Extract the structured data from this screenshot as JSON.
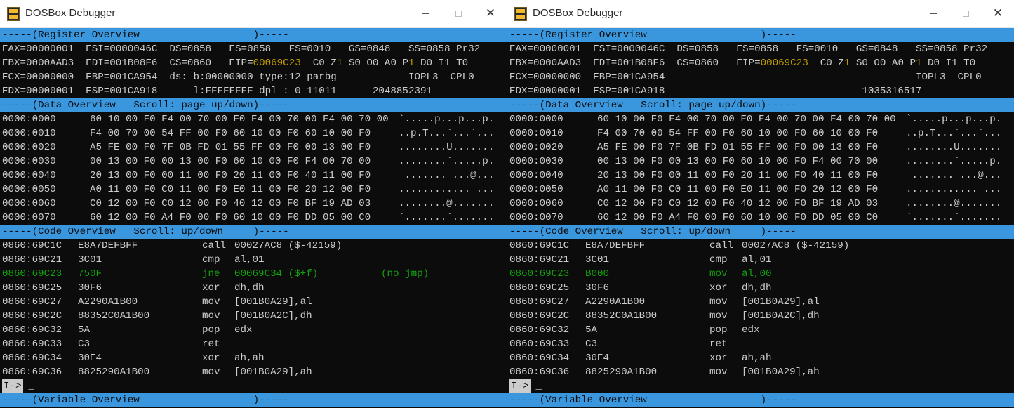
{
  "windows": {
    "left": {
      "title": "DOSBox Debugger",
      "registers": {
        "header": "-----(Register Overview                   )-----",
        "r1": {
          "a": "EAX=00000001  ESI=0000046C  DS=0858   ES=0858   FS=0010   GS=0848   SS=0858 Pr32",
          "eip_val": "",
          "b": ""
        },
        "r2": {
          "a": "EBX=0000AAD3  EDI=001B08F6  CS=0860   EIP=",
          "eip_val": "00069C23",
          "flags_a": "  C0 Z",
          "z": "1",
          "flags_b": " S0 O0 A0 P",
          "p": "1",
          "flags_c": " D0 I1 T0"
        },
        "r3": "ECX=00000000  EBP=001CA954  ds: b:00000000 type:12 parbg            IOPL3  CPL0",
        "r4": "EDX=00000001  ESP=001CA918      l:FFFFFFFF dpl : 0 11011      2048852391"
      },
      "data": {
        "header": "-----(Data Overview   Scroll: page up/down)-----",
        "rows": [
          {
            "addr": "0000:0000",
            "hex": "60 10 00 F0 F4 00 70 00 F0 F4 00 70 00 F4 00 70 00",
            "ascii": "`.....p...p...p."
          },
          {
            "addr": "0000:0010",
            "hex": "F4 00 70 00 54 FF 00 F0 60 10 00 F0 60 10 00 F0",
            "ascii": "..p.T...`...`..."
          },
          {
            "addr": "0000:0020",
            "hex": "A5 FE 00 F0 7F 0B FD 01 55 FF 00 F0 00 13 00 F0",
            "ascii": "........U......."
          },
          {
            "addr": "0000:0030",
            "hex": "00 13 00 F0 00 13 00 F0 60 10 00 F0 F4 00 70 00",
            "ascii": "........`.....p."
          },
          {
            "addr": "0000:0040",
            "hex": "20 13 00 F0 00 11 00 F0 20 11 00 F0 40 11 00 F0",
            "ascii": " ....... ...@..."
          },
          {
            "addr": "0000:0050",
            "hex": "A0 11 00 F0 C0 11 00 F0 E0 11 00 F0 20 12 00 F0",
            "ascii": "............ ..."
          },
          {
            "addr": "0000:0060",
            "hex": "C0 12 00 F0 C0 12 00 F0 40 12 00 F0 BF 19 AD 03",
            "ascii": "........@......."
          },
          {
            "addr": "0000:0070",
            "hex": "60 12 00 F0 A4 F0 00 F0 60 10 00 F0 DD 05 00 C0",
            "ascii": "`.......`......."
          }
        ]
      },
      "code": {
        "header": "-----(Code Overview   Scroll: up/down     )-----",
        "rows": [
          {
            "addr": "0860:69C1C",
            "bytes": "E8A7DEFBFF",
            "mn": "call",
            "op": "00027AC8 ($-42159)",
            "note": "",
            "hl": false
          },
          {
            "addr": "0860:69C21",
            "bytes": "3C01",
            "mn": "cmp",
            "op": "al,01",
            "note": "",
            "hl": false
          },
          {
            "addr": "0860:69C23",
            "bytes": "750F",
            "mn": "jne",
            "op": "00069C34 ($+f)",
            "note": "(no jmp)",
            "hl": true
          },
          {
            "addr": "0860:69C25",
            "bytes": "30F6",
            "mn": "xor",
            "op": "dh,dh",
            "note": "",
            "hl": false
          },
          {
            "addr": "0860:69C27",
            "bytes": "A2290A1B00",
            "mn": "mov",
            "op": "[001B0A29],al",
            "note": "",
            "hl": false
          },
          {
            "addr": "0860:69C2C",
            "bytes": "88352C0A1B00",
            "mn": "mov",
            "op": "[001B0A2C],dh",
            "note": "",
            "hl": false
          },
          {
            "addr": "0860:69C32",
            "bytes": "5A",
            "mn": "pop",
            "op": "edx",
            "note": "",
            "hl": false
          },
          {
            "addr": "0860:69C33",
            "bytes": "C3",
            "mn": "ret",
            "op": "",
            "note": "",
            "hl": false
          },
          {
            "addr": "0860:69C34",
            "bytes": "30E4",
            "mn": "xor",
            "op": "ah,ah",
            "note": "",
            "hl": false
          },
          {
            "addr": "0860:69C36",
            "bytes": "8825290A1B00",
            "mn": "mov",
            "op": "[001B0A29],ah",
            "note": "",
            "hl": false
          }
        ]
      },
      "prompt": "I->",
      "cursor": "_",
      "variables_header": "-----(Variable Overview                   )-----"
    },
    "right": {
      "title": "DOSBox Debugger",
      "registers": {
        "header": "-----(Register Overview                   )-----",
        "r1": {
          "a": "EAX=00000001  ESI=0000046C  DS=0858   ES=0858   FS=0010   GS=0848   SS=0858 Pr32",
          "eip_val": "",
          "b": ""
        },
        "r2": {
          "a": "EBX=0000AAD3  EDI=001B08F6  CS=0860   EIP=",
          "eip_val": "00069C23",
          "flags_a": "  C0 Z",
          "z": "1",
          "flags_b": " S0 O0 A0 P",
          "p": "1",
          "flags_c": " D0 I1 T0"
        },
        "r3": "ECX=00000000  EBP=001CA954                                          IOPL3  CPL0",
        "r4": "EDX=00000001  ESP=001CA918                                 1035316517"
      },
      "data": {
        "header": "-----(Data Overview   Scroll: page up/down)-----",
        "rows": [
          {
            "addr": "0000:0000",
            "hex": "60 10 00 F0 F4 00 70 00 F0 F4 00 70 00 F4 00 70 00",
            "ascii": "`.....p...p...p."
          },
          {
            "addr": "0000:0010",
            "hex": "F4 00 70 00 54 FF 00 F0 60 10 00 F0 60 10 00 F0",
            "ascii": "..p.T...`...`..."
          },
          {
            "addr": "0000:0020",
            "hex": "A5 FE 00 F0 7F 0B FD 01 55 FF 00 F0 00 13 00 F0",
            "ascii": "........U......."
          },
          {
            "addr": "0000:0030",
            "hex": "00 13 00 F0 00 13 00 F0 60 10 00 F0 F4 00 70 00",
            "ascii": "........`.....p."
          },
          {
            "addr": "0000:0040",
            "hex": "20 13 00 F0 00 11 00 F0 20 11 00 F0 40 11 00 F0",
            "ascii": " ....... ...@..."
          },
          {
            "addr": "0000:0050",
            "hex": "A0 11 00 F0 C0 11 00 F0 E0 11 00 F0 20 12 00 F0",
            "ascii": "............ ..."
          },
          {
            "addr": "0000:0060",
            "hex": "C0 12 00 F0 C0 12 00 F0 40 12 00 F0 BF 19 AD 03",
            "ascii": "........@......."
          },
          {
            "addr": "0000:0070",
            "hex": "60 12 00 F0 A4 F0 00 F0 60 10 00 F0 DD 05 00 C0",
            "ascii": "`.......`......."
          }
        ]
      },
      "code": {
        "header": "-----(Code Overview   Scroll: up/down     )-----",
        "rows": [
          {
            "addr": "0860:69C1C",
            "bytes": "E8A7DEFBFF",
            "mn": "call",
            "op": "00027AC8 ($-42159)",
            "note": "",
            "hl": false
          },
          {
            "addr": "0860:69C21",
            "bytes": "3C01",
            "mn": "cmp",
            "op": "al,01",
            "note": "",
            "hl": false
          },
          {
            "addr": "0860:69C23",
            "bytes": "B000",
            "mn": "mov",
            "op": "al,00",
            "note": "",
            "hl": true
          },
          {
            "addr": "0860:69C25",
            "bytes": "30F6",
            "mn": "xor",
            "op": "dh,dh",
            "note": "",
            "hl": false
          },
          {
            "addr": "0860:69C27",
            "bytes": "A2290A1B00",
            "mn": "mov",
            "op": "[001B0A29],al",
            "note": "",
            "hl": false
          },
          {
            "addr": "0860:69C2C",
            "bytes": "88352C0A1B00",
            "mn": "mov",
            "op": "[001B0A2C],dh",
            "note": "",
            "hl": false
          },
          {
            "addr": "0860:69C32",
            "bytes": "5A",
            "mn": "pop",
            "op": "edx",
            "note": "",
            "hl": false
          },
          {
            "addr": "0860:69C33",
            "bytes": "C3",
            "mn": "ret",
            "op": "",
            "note": "",
            "hl": false
          },
          {
            "addr": "0860:69C34",
            "bytes": "30E4",
            "mn": "xor",
            "op": "ah,ah",
            "note": "",
            "hl": false
          },
          {
            "addr": "0860:69C36",
            "bytes": "8825290A1B00",
            "mn": "mov",
            "op": "[001B0A29],ah",
            "note": "",
            "hl": false
          }
        ]
      },
      "prompt": "I->",
      "cursor": "_",
      "variables_header": "-----(Variable Overview                   )-----"
    }
  },
  "colors": {
    "header_bg": "#3a96dd",
    "console_bg": "#0c0c0c",
    "text": "#cccccc",
    "highlight_yellow": "#c19c00",
    "highlight_green": "#13a10e"
  },
  "icons": {
    "app": "dosbox-icon",
    "minimize": "minimize-icon",
    "maximize": "maximize-icon",
    "close": "close-icon"
  }
}
